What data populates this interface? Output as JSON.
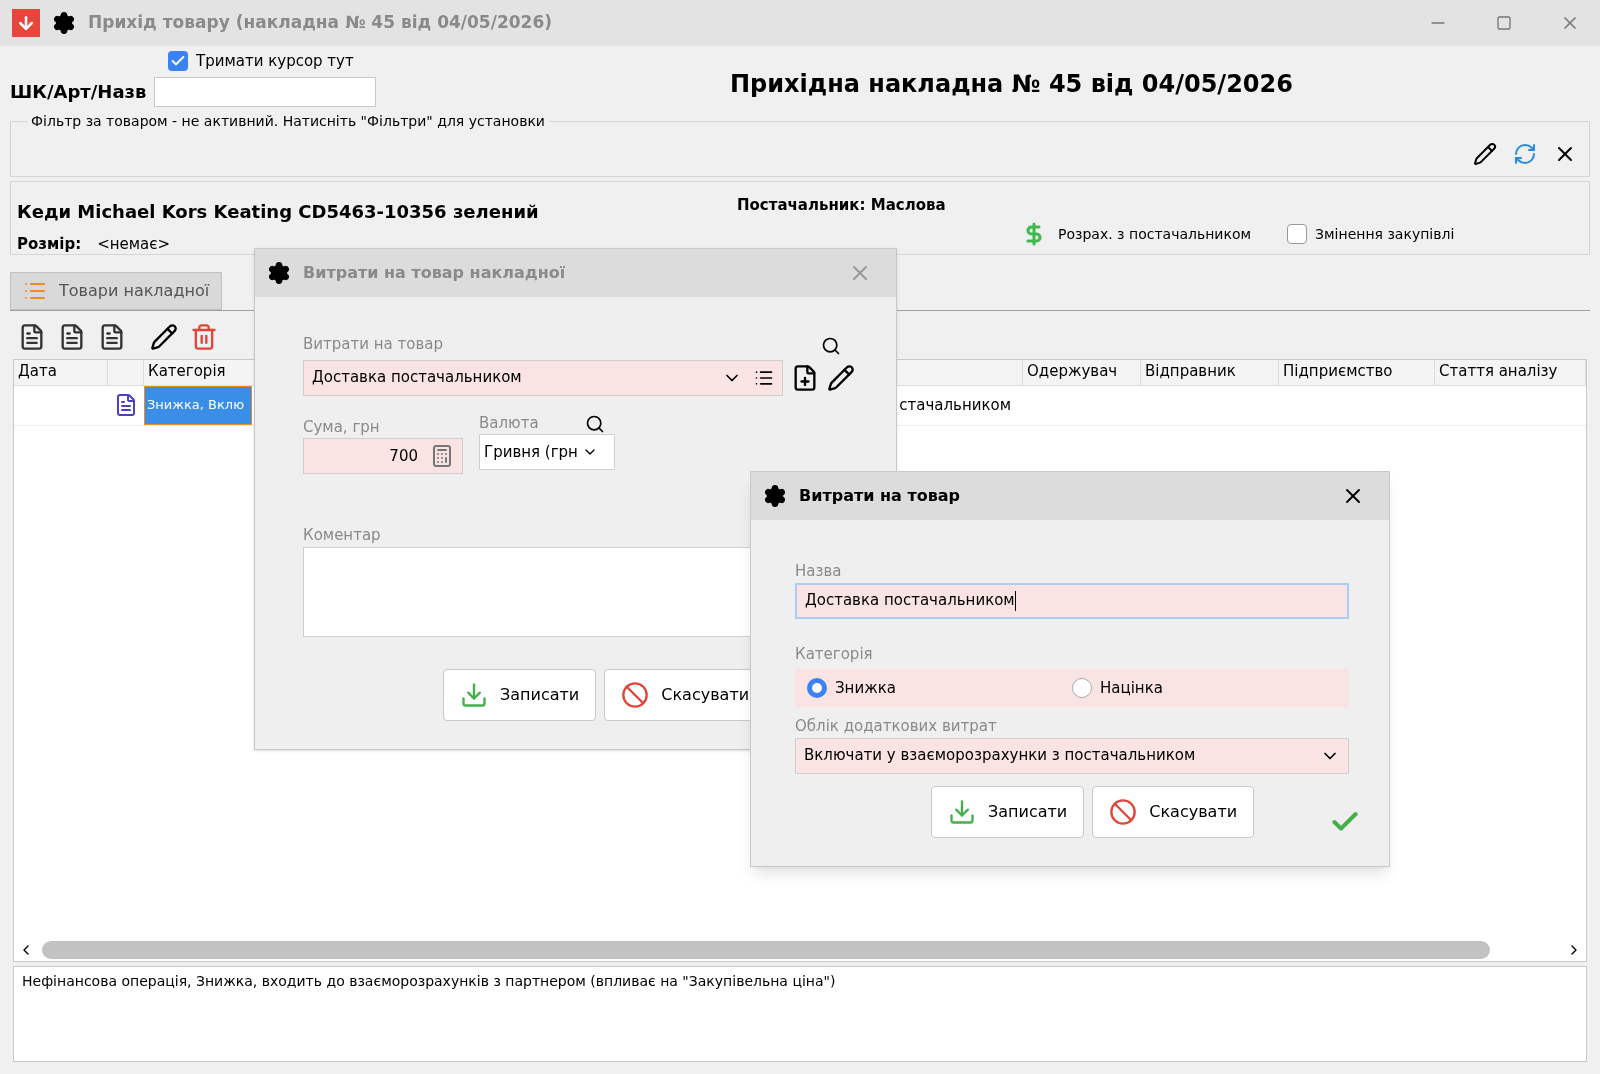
{
  "window": {
    "title": "Прихід товару (накладна № 45 від 04/05/2026)"
  },
  "search": {
    "keep_cursor": {
      "label": "Тримати курсор тут",
      "checked": true
    },
    "label": "ШК/Арт/Назв"
  },
  "heading": "Прихідна накладна № 45 від 04/05/2026",
  "filter_note": "Фільтр за товаром - не активний. Натисніть \"Фільтри\" для установки",
  "product": {
    "name": "Кеди Michael Kors Keating CD5463-10356 зелений",
    "size_label": "Розмір:",
    "size_value": "<немає>",
    "supplier": "Постачальник: Маслова",
    "settlement": "Розрах. з постачальником",
    "purchase_change": {
      "label": "Змінення закупівлі",
      "checked": false
    }
  },
  "tabs": [
    {
      "label": "Товари накладної",
      "selected": true
    }
  ],
  "table": {
    "columns": [
      "Дата",
      "",
      "Категорія",
      "Одержувач",
      "Відправник",
      "Підприємство",
      "Стаття аналізу"
    ],
    "rows": [
      {
        "selected": true,
        "category": "Знижка, Вклю",
        "column_4": "стачальником"
      }
    ]
  },
  "status_text": "Нефінансова операція, Знижка, входить до взаєморозрахунків з партнером (впливає на \"Закупівельна ціна\")",
  "dialog_costs": {
    "title": "Витрати на товар накладної",
    "cost_label": "Витрати на товар",
    "cost_value": "Доставка постачальником",
    "sum_label": "Сума, грн",
    "sum_value": "700",
    "currency_label": "Валюта",
    "currency_value": "Гривня (грн",
    "comment_label": "Коментар",
    "buttons": [
      "Записати",
      "Скасувати"
    ]
  },
  "dialog_item": {
    "title": "Витрати на товар",
    "name_label": "Назва",
    "name_value": "Доставка постачальником",
    "category_label": "Категорія",
    "categories": [
      {
        "label": "Знижка",
        "selected": true
      },
      {
        "label": "Націнка",
        "selected": false
      }
    ],
    "accounting_label": "Облік додаткових витрат",
    "accounting_value": "Включати у взаєморозрахунки з постачальником",
    "buttons": [
      "Записати",
      "Скасувати"
    ]
  }
}
